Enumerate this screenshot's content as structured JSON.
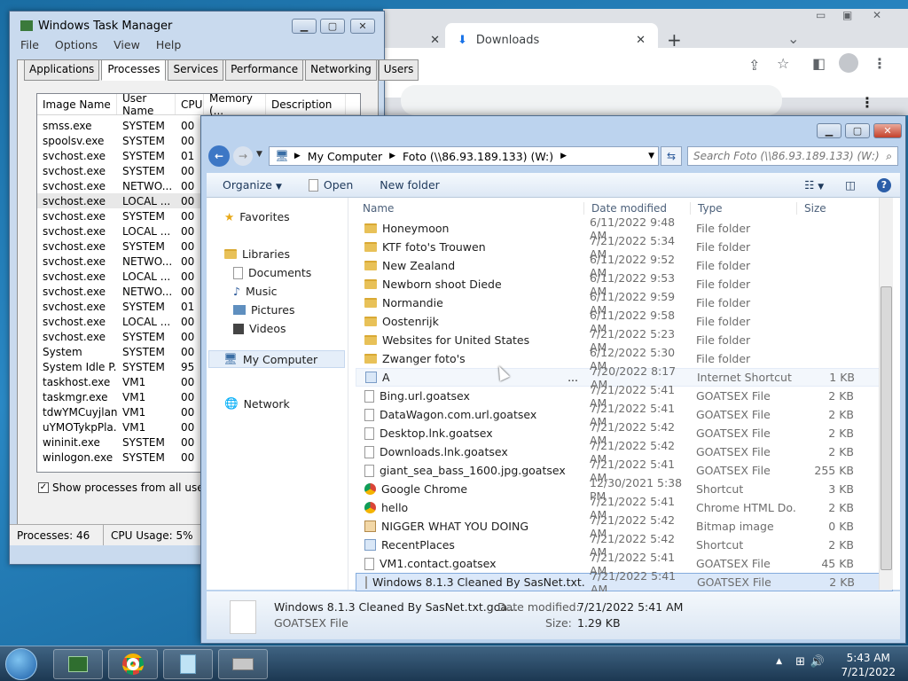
{
  "chrome": {
    "tab_close": "✕",
    "active_tab": "Downloads",
    "new_tab": "+"
  },
  "taskmgr": {
    "title": "Windows Task Manager",
    "menu": [
      "File",
      "Options",
      "View",
      "Help"
    ],
    "tabs": [
      "Applications",
      "Processes",
      "Services",
      "Performance",
      "Networking",
      "Users"
    ],
    "columns": [
      "Image Name",
      "User Name",
      "CPU",
      "Memory (...",
      "Description"
    ],
    "rows": [
      [
        "smss.exe",
        "SYSTEM",
        "00"
      ],
      [
        "spoolsv.exe",
        "SYSTEM",
        "00"
      ],
      [
        "svchost.exe",
        "SYSTEM",
        "01"
      ],
      [
        "svchost.exe",
        "SYSTEM",
        "00"
      ],
      [
        "svchost.exe",
        "NETWO...",
        "00"
      ],
      [
        "svchost.exe",
        "LOCAL ...",
        "00"
      ],
      [
        "svchost.exe",
        "SYSTEM",
        "00"
      ],
      [
        "svchost.exe",
        "LOCAL ...",
        "00"
      ],
      [
        "svchost.exe",
        "SYSTEM",
        "00"
      ],
      [
        "svchost.exe",
        "NETWO...",
        "00"
      ],
      [
        "svchost.exe",
        "LOCAL ...",
        "00"
      ],
      [
        "svchost.exe",
        "NETWO...",
        "00"
      ],
      [
        "svchost.exe",
        "SYSTEM",
        "01"
      ],
      [
        "svchost.exe",
        "LOCAL ...",
        "00"
      ],
      [
        "svchost.exe",
        "SYSTEM",
        "00"
      ],
      [
        "System",
        "SYSTEM",
        "00"
      ],
      [
        "System Idle P...",
        "SYSTEM",
        "95"
      ],
      [
        "taskhost.exe",
        "VM1",
        "00"
      ],
      [
        "taskmgr.exe",
        "VM1",
        "00"
      ],
      [
        "tdwYMCuyjlan...",
        "VM1",
        "00"
      ],
      [
        "uYMOTykpPla...",
        "VM1",
        "00"
      ],
      [
        "wininit.exe",
        "SYSTEM",
        "00"
      ],
      [
        "winlogon.exe",
        "SYSTEM",
        "00"
      ]
    ],
    "show_all": "Show processes from all users",
    "processes": "Processes: 46",
    "cpu": "CPU Usage: 5%"
  },
  "explorer": {
    "breadcrumb": [
      "My Computer",
      "Foto (\\\\86.93.189.133) (W:)"
    ],
    "search_placeholder": "Search Foto (\\\\86.93.189.133) (W:)",
    "toolbar": {
      "organize": "Organize",
      "open": "Open",
      "new_folder": "New folder"
    },
    "nav": {
      "favorites": "Favorites",
      "libraries": "Libraries",
      "documents": "Documents",
      "music": "Music",
      "pictures": "Pictures",
      "videos": "Videos",
      "computer": "My Computer",
      "network": "Network"
    },
    "columns": {
      "name": "Name",
      "date": "Date modified",
      "type": "Type",
      "size": "Size"
    },
    "files": [
      {
        "name": "Honeymoon",
        "date": "6/11/2022 9:48 AM",
        "type": "File folder",
        "size": "",
        "icon": "folder"
      },
      {
        "name": "KTF foto's Trouwen",
        "date": "7/21/2022 5:34 AM",
        "type": "File folder",
        "size": "",
        "icon": "folder"
      },
      {
        "name": "New Zealand",
        "date": "6/11/2022 9:52 AM",
        "type": "File folder",
        "size": "",
        "icon": "folder"
      },
      {
        "name": "Newborn shoot Diede",
        "date": "6/11/2022 9:53 AM",
        "type": "File folder",
        "size": "",
        "icon": "folder"
      },
      {
        "name": "Normandie",
        "date": "6/11/2022 9:59 AM",
        "type": "File folder",
        "size": "",
        "icon": "folder"
      },
      {
        "name": "Oostenrijk",
        "date": "6/11/2022 9:58 AM",
        "type": "File folder",
        "size": "",
        "icon": "folder"
      },
      {
        "name": "Websites for United States",
        "date": "7/21/2022 5:23 AM",
        "type": "File folder",
        "size": "",
        "icon": "folder"
      },
      {
        "name": "Zwanger foto's",
        "date": "6/12/2022 5:30 AM",
        "type": "File folder",
        "size": "",
        "icon": "folder"
      },
      {
        "name": "A",
        "date": "7/20/2022 8:17 AM",
        "type": "Internet Shortcut",
        "size": "1 KB",
        "icon": "shortcut"
      },
      {
        "name": "Bing.url.goatsex",
        "date": "7/21/2022 5:41 AM",
        "type": "GOATSEX File",
        "size": "2 KB",
        "icon": "doc"
      },
      {
        "name": "DataWagon.com.url.goatsex",
        "date": "7/21/2022 5:41 AM",
        "type": "GOATSEX File",
        "size": "2 KB",
        "icon": "doc"
      },
      {
        "name": "Desktop.lnk.goatsex",
        "date": "7/21/2022 5:42 AM",
        "type": "GOATSEX File",
        "size": "2 KB",
        "icon": "doc"
      },
      {
        "name": "Downloads.lnk.goatsex",
        "date": "7/21/2022 5:42 AM",
        "type": "GOATSEX File",
        "size": "2 KB",
        "icon": "doc"
      },
      {
        "name": "giant_sea_bass_1600.jpg.goatsex",
        "date": "7/21/2022 5:41 AM",
        "type": "GOATSEX File",
        "size": "255 KB",
        "icon": "doc"
      },
      {
        "name": "Google Chrome",
        "date": "12/30/2021 5:38 PM",
        "type": "Shortcut",
        "size": "3 KB",
        "icon": "chrome"
      },
      {
        "name": "hello",
        "date": "7/21/2022 5:41 AM",
        "type": "Chrome HTML Do...",
        "size": "2 KB",
        "icon": "chrome"
      },
      {
        "name": "NIGGER WHAT YOU DOING",
        "date": "7/21/2022 5:42 AM",
        "type": "Bitmap image",
        "size": "0 KB",
        "icon": "image"
      },
      {
        "name": "RecentPlaces",
        "date": "7/21/2022 5:42 AM",
        "type": "Shortcut",
        "size": "2 KB",
        "icon": "shortcut"
      },
      {
        "name": "VM1.contact.goatsex",
        "date": "7/21/2022 5:41 AM",
        "type": "GOATSEX File",
        "size": "45 KB",
        "icon": "doc"
      },
      {
        "name": "Windows 8.1.3 Cleaned By SasNet.txt.goa...",
        "date": "7/21/2022 5:41 AM",
        "type": "GOATSEX File",
        "size": "2 KB",
        "icon": "doc"
      }
    ],
    "hover_ellipsis": "...",
    "details": {
      "name": "Windows 8.1.3 Cleaned By SasNet.txt.goa...",
      "type": "GOATSEX File",
      "date_label": "Date modified:",
      "date": "7/21/2022 5:41 AM",
      "size_label": "Size:",
      "size": "1.29 KB"
    }
  },
  "clock": {
    "time": "5:43 AM",
    "date": "7/21/2022"
  }
}
